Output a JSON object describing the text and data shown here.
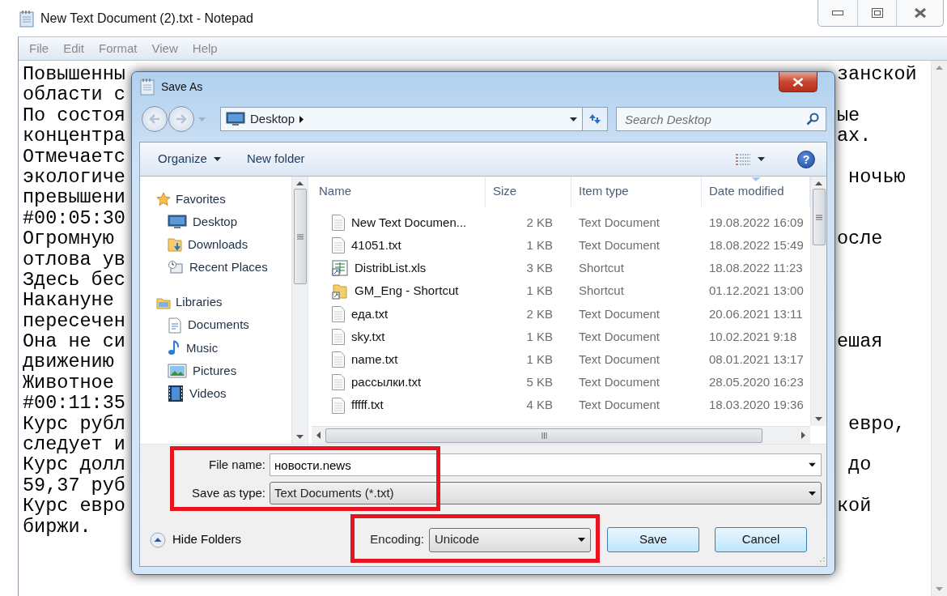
{
  "notepad": {
    "title": "New Text Document (2).txt - Notepad",
    "menu": [
      "File",
      "Edit",
      "Format",
      "View",
      "Help"
    ],
    "lines": [
      {
        "left": "Повышенны",
        "right": "занской"
      },
      {
        "left": "области с"
      },
      {
        "left": "По состоя",
        "right": "ые"
      },
      {
        "left": "концентра",
        "right": "ах."
      },
      {
        "left": "Отмечаетс"
      },
      {
        "left": "экологиче",
        "right": " ночью"
      },
      {
        "left": "превышени"
      },
      {
        "left": "#00:05:30"
      },
      {
        "left": "Огромную",
        "right": "осле"
      },
      {
        "left": "отлова ув"
      },
      {
        "left": "Здесь бес"
      },
      {
        "left": "Накануне"
      },
      {
        "left": "пересечен"
      },
      {
        "left": "Она не си",
        "right": "ешая"
      },
      {
        "left": "движению"
      },
      {
        "left": "Животное"
      },
      {
        "left": "#00:11:35"
      },
      {
        "left": "Курс рубл",
        "right": " евро,"
      },
      {
        "left": "следует и"
      },
      {
        "left": "Курс долл",
        "right": " до"
      },
      {
        "left": "59,37 руб"
      },
      {
        "left": "Курс евро",
        "right": "кой"
      },
      {
        "left": "биржи."
      }
    ]
  },
  "dialog": {
    "title": "Save As",
    "address": "Desktop",
    "search": {
      "placeholder": "Search Desktop"
    },
    "toolbar": {
      "organize": "Organize",
      "new_folder": "New folder",
      "help": "?"
    },
    "nav": [
      {
        "label": "Favorites",
        "children": [
          {
            "label": "Desktop"
          },
          {
            "label": "Downloads"
          },
          {
            "label": "Recent Places"
          }
        ]
      },
      {
        "label": "Libraries",
        "children": [
          {
            "label": "Documents"
          },
          {
            "label": "Music"
          },
          {
            "label": "Pictures"
          },
          {
            "label": "Videos"
          }
        ]
      }
    ],
    "columns": [
      {
        "label": "Name",
        "sorted": false
      },
      {
        "label": "Size",
        "sorted": false
      },
      {
        "label": "Item type",
        "sorted": false
      },
      {
        "label": "Date modified",
        "sorted": true
      }
    ],
    "files": [
      {
        "kind": "document",
        "name": "New Text Documen...",
        "size": "2 KB",
        "type": "Text Document",
        "date": "19.08.2022 16:09"
      },
      {
        "kind": "document",
        "name": "41051.txt",
        "size": "1 KB",
        "type": "Text Document",
        "date": "18.08.2022 15:49"
      },
      {
        "kind": "spreadsheet",
        "name": "DistribList.xls",
        "size": "3 KB",
        "type": "Shortcut",
        "date": "18.08.2022 11:23"
      },
      {
        "kind": "shortcut",
        "name": "GM_Eng - Shortcut",
        "size": "1 KB",
        "type": "Shortcut",
        "date": "01.12.2021 13:00"
      },
      {
        "kind": "document",
        "name": "еда.txt",
        "size": "2 KB",
        "type": "Text Document",
        "date": "20.06.2021 13:11"
      },
      {
        "kind": "document",
        "name": "sky.txt",
        "size": "1 KB",
        "type": "Text Document",
        "date": "10.02.2021 9:18"
      },
      {
        "kind": "document",
        "name": "name.txt",
        "size": "1 KB",
        "type": "Text Document",
        "date": "08.01.2021 13:17"
      },
      {
        "kind": "document",
        "name": "рассылки.txt",
        "size": "5 KB",
        "type": "Text Document",
        "date": "28.05.2020 16:23"
      },
      {
        "kind": "document",
        "name": "fffff.txt",
        "size": "4 KB",
        "type": "Text Document",
        "date": "18.03.2020 19:36"
      }
    ],
    "file_name": {
      "label": "File name:",
      "value": "новости.news"
    },
    "save_type": {
      "label": "Save as type:",
      "value": "Text Documents (*.txt)"
    },
    "hide_folders": "Hide Folders",
    "encoding": {
      "label": "Encoding:",
      "value": "Unicode"
    },
    "buttons": [
      "Save",
      "Cancel"
    ]
  },
  "annotations": [
    {
      "kind": "frame"
    },
    {
      "kind": "frame"
    }
  ]
}
